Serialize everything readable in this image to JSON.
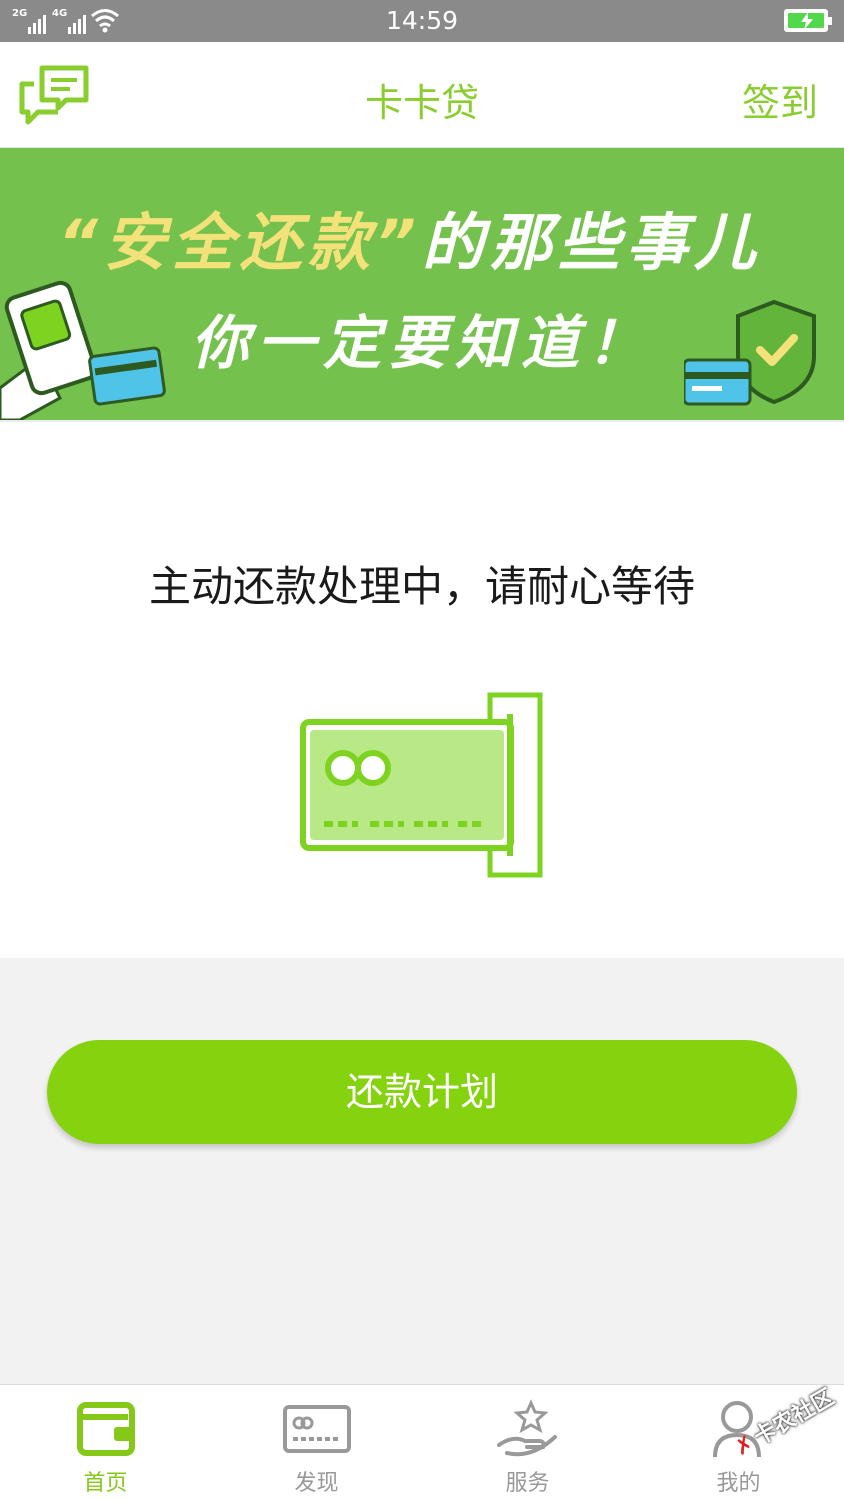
{
  "status_bar": {
    "time": "14:59",
    "network_1": "2G",
    "network_2": "4G",
    "battery_state": "charging",
    "wifi_icon": "wifi-icon"
  },
  "header": {
    "title": "卡卡贷",
    "sign_in": "签到",
    "left_icon": "message-chat-icon",
    "accent_color": "#89cd2f"
  },
  "banner": {
    "line1_quoted": "“安全还款”",
    "line1_rest": "的那些事儿",
    "line2": "你一定要知道！",
    "background": "#75c14d"
  },
  "main": {
    "status_text": "主动还款处理中，请耐心等待",
    "illustration": "credit-card-slot-icon"
  },
  "plan_button": {
    "label": "还款计划",
    "color": "#85d20f"
  },
  "tabbar": {
    "tabs": [
      {
        "label": "首页",
        "icon": "wallet-icon",
        "active": true
      },
      {
        "label": "发现",
        "icon": "card-icon",
        "active": false
      },
      {
        "label": "服务",
        "icon": "hand-star-icon",
        "active": false
      },
      {
        "label": "我的",
        "icon": "user-icon",
        "active": false
      }
    ]
  },
  "watermark": {
    "text": "卡农社区"
  }
}
